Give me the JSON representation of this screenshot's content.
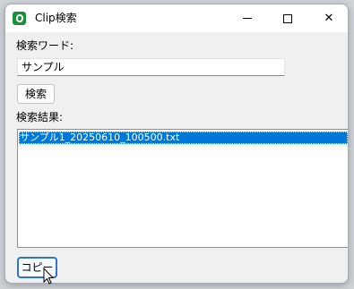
{
  "window": {
    "title": "Clip検索",
    "app_icon": "clip-app-icon",
    "controls": {
      "minimize_icon": "minimize-icon",
      "maximize_icon": "maximize-icon",
      "close_icon": "close-icon",
      "close_glyph": "✕"
    }
  },
  "search": {
    "label": "検索ワード:",
    "value": "サンプル",
    "button_label": "検索"
  },
  "results": {
    "label": "検索結果:",
    "items": [
      {
        "text": "サンプル1_20250610_100500.txt",
        "selected": true
      }
    ]
  },
  "actions": {
    "copy_label": "コピー"
  },
  "colors": {
    "selection": "#0078d7",
    "focus_border": "#2f74c9",
    "app_icon": "#1e8e3e"
  }
}
